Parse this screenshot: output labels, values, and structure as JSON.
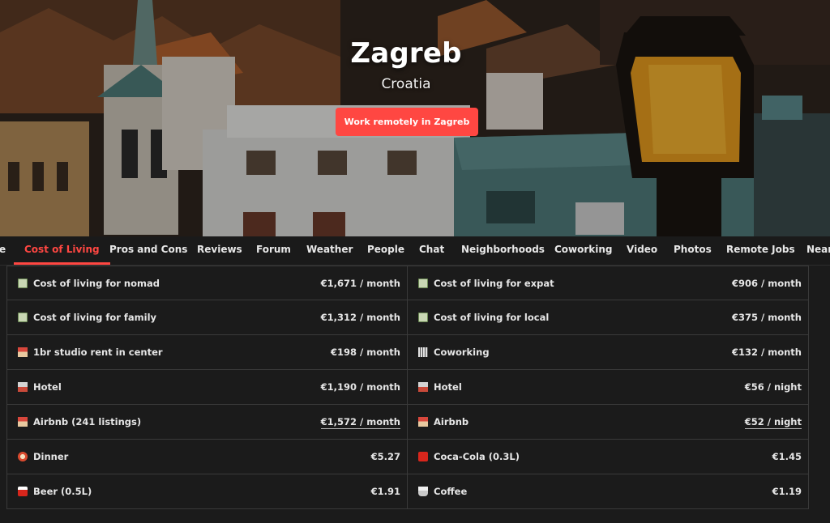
{
  "hero": {
    "city": "Zagreb",
    "country": "Croatia",
    "cta_label": "Work remotely in Zagreb"
  },
  "tabs": [
    {
      "label": "e"
    },
    {
      "label": "Cost of Living",
      "active": true
    },
    {
      "label": "Pros and Cons"
    },
    {
      "label": "Reviews"
    },
    {
      "label": "Forum"
    },
    {
      "label": "Weather"
    },
    {
      "label": "People"
    },
    {
      "label": "Chat"
    },
    {
      "label": "Neighborhoods"
    },
    {
      "label": "Coworking"
    },
    {
      "label": "Video"
    },
    {
      "label": "Photos"
    },
    {
      "label": "Remote Jobs"
    },
    {
      "label": "Near"
    }
  ],
  "cost": {
    "rows": [
      {
        "left": {
          "icon": "money-icon",
          "label": "Cost of living for nomad",
          "value": "€1,671 / month"
        },
        "right": {
          "icon": "money-icon",
          "label": "Cost of living for expat",
          "value": "€906 / month"
        }
      },
      {
        "left": {
          "icon": "money-icon",
          "label": "Cost of living for family",
          "value": "€1,312 / month"
        },
        "right": {
          "icon": "money-icon",
          "label": "Cost of living for local",
          "value": "€375 / month"
        }
      },
      {
        "left": {
          "icon": "house-icon",
          "label": "1br studio rent in center",
          "value": "€198 / month"
        },
        "right": {
          "icon": "office-building-icon",
          "label": "Coworking",
          "value": "€132 / month"
        }
      },
      {
        "left": {
          "icon": "hotel-icon",
          "label": "Hotel",
          "value": "€1,190 / month"
        },
        "right": {
          "icon": "hotel-icon",
          "label": "Hotel",
          "value": "€56 / night"
        }
      },
      {
        "left": {
          "icon": "house-icon",
          "label": "Airbnb (241 listings)",
          "value": "€1,572 / month",
          "link": true
        },
        "right": {
          "icon": "house-icon",
          "label": "Airbnb",
          "value": "€52 / night",
          "link": true
        }
      },
      {
        "left": {
          "icon": "dinner-plate-icon",
          "label": "Dinner",
          "value": "€5.27"
        },
        "right": {
          "icon": "cola-cup-icon",
          "label": "Coca-Cola (0.3L)",
          "value": "€1.45"
        }
      },
      {
        "left": {
          "icon": "beer-icon",
          "label": "Beer (0.5L)",
          "value": "€1.91"
        },
        "right": {
          "icon": "coffee-cup-icon",
          "label": "Coffee",
          "value": "€1.19"
        }
      }
    ]
  },
  "colors": {
    "accent": "#ff4742",
    "background": "#1b1b1b",
    "border": "#3a3a3a"
  }
}
